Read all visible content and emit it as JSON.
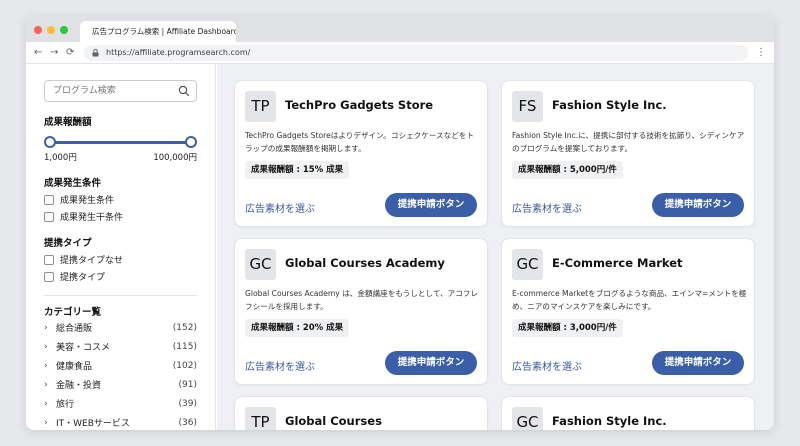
{
  "browser": {
    "tab_title": "広告プログラム検索 | Affiliate Dashboard",
    "url": "https://affiliate.programsearch.com/"
  },
  "sidebar": {
    "search_placeholder": "プログラム検索",
    "reward_section": "成果報酬額",
    "reward_min": "1,000円",
    "reward_max": "100,000円",
    "condition_section": "成果発生条件",
    "conditions": [
      "成果発生条件",
      "成果発生干条件"
    ],
    "type_section": "提携タイプ",
    "types": [
      "提携タイプなせ",
      "提携タイプ"
    ],
    "category_section": "カテゴリー覧",
    "categories": [
      {
        "label": "総合通販",
        "count": "(152)"
      },
      {
        "label": "美容・コスメ",
        "count": "(115)"
      },
      {
        "label": "健康食品",
        "count": "(102)"
      },
      {
        "label": "金融・投資",
        "count": "(91)"
      },
      {
        "label": "旅行",
        "count": "(39)"
      },
      {
        "label": "IT・WEBサービス",
        "count": "(36)"
      }
    ]
  },
  "cards": [
    {
      "logo": "TP",
      "name": "TechPro Gadgets Store",
      "desc": "TechPro Gadgets Storeはよりデザイン。コシェクケースなどをトラップの成果報酬額を掲期します。",
      "reward": "成果報酬額 : 15% 成果",
      "material": "広告素材を選ぶ",
      "apply": "提携申請ボタン"
    },
    {
      "logo": "FS",
      "name": "Fashion Style Inc.",
      "desc": "Fashion Style Inc.に、提携に部付する技術を拡節り、シディンケアのプログラムを提案しております。",
      "reward": "成果報酬額 : 5,000円/件",
      "material": "広告素材を選ぶ",
      "apply": "提携申請ボタン"
    },
    {
      "logo": "GC",
      "name": "Global Courses Academy",
      "desc": "Global Courses Academy は、金額講座をもうしとして、アコフレフシールを採用します。",
      "reward": "成果報酬額 : 20% 成果",
      "material": "広告素材を選ぶ",
      "apply": "提携申請ボタン"
    },
    {
      "logo": "GC",
      "name": "E-Commerce Market",
      "desc": "E-commerce Marketをブログるような商品、エインマ=メントを極め、ニアのマインスケアを楽しみにです。",
      "reward": "成果報酬額 : 3,000円/件",
      "material": "広告素材を選ぶ",
      "apply": "提携申請ボタン"
    },
    {
      "logo": "TP",
      "name": "Global Courses"
    },
    {
      "logo": "GC",
      "name": "Fashion Style Inc."
    }
  ]
}
